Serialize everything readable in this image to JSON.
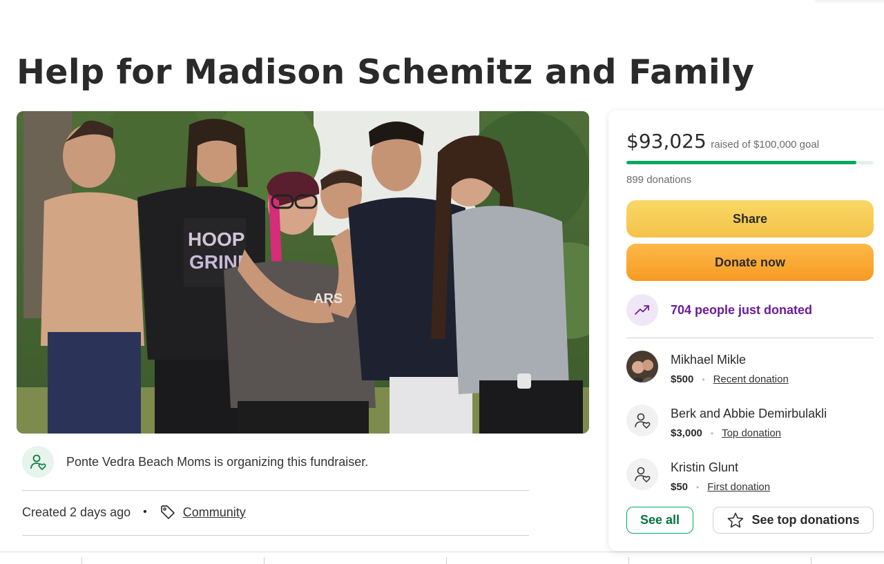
{
  "campaign": {
    "title": "Help for Madison Schemitz and Family",
    "organizer_text": "Ponte Vedra Beach Moms is organizing this fundraiser.",
    "created": "Created 2 days ago",
    "category": "Community",
    "photo_shirt_text": "HOOP GRIND",
    "photo_shirt_text_2": "ARS"
  },
  "donation_panel": {
    "amount_raised": "$93,025",
    "goal_text": "raised of $100,000 goal",
    "progress": 0.93,
    "donations_count": "899 donations",
    "share_label": "Share",
    "donate_label": "Donate now",
    "recent_activity": "704 people just donated",
    "donors": [
      {
        "name": "Mikhael Mikle",
        "amount": "$500",
        "type": "Recent donation",
        "avatar": "photo"
      },
      {
        "name": "Berk and Abbie Demirbulakli",
        "amount": "$3,000",
        "type": "Top donation",
        "avatar": "donor-icon"
      },
      {
        "name": "Kristin Glunt",
        "amount": "$50",
        "type": "First donation",
        "avatar": "donor-icon"
      }
    ],
    "see_all_label": "See all",
    "see_top_label": "See top donations"
  },
  "colors": {
    "brand_green": "#02a95c",
    "share_yellow": "#f4c24a",
    "donate_orange": "#f79a24",
    "activity_purple": "#6a1b9a"
  }
}
